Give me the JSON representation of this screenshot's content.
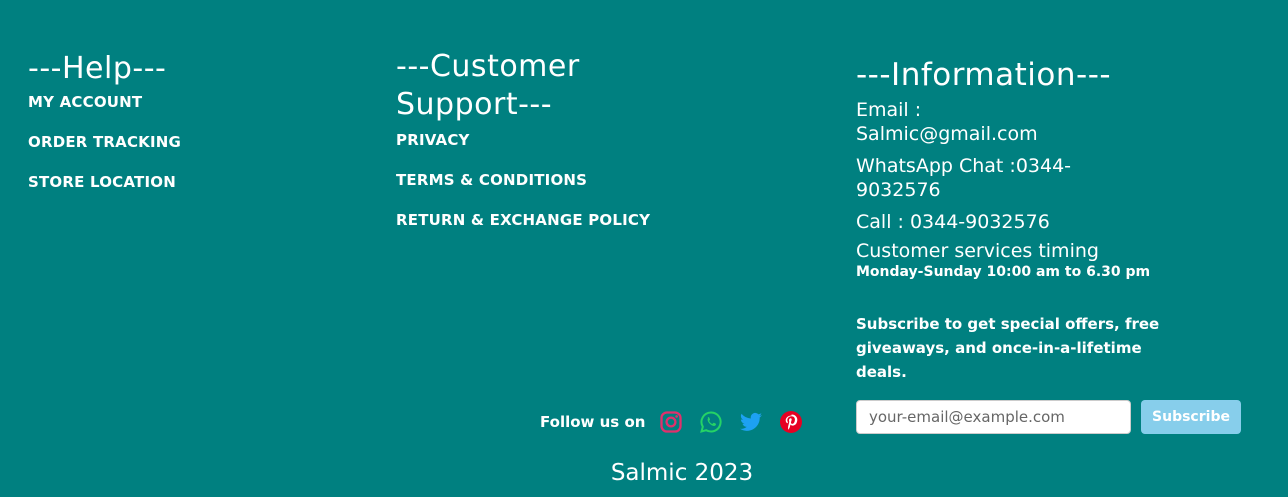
{
  "help": {
    "heading": "---Help---",
    "links": [
      "MY ACCOUNT",
      "ORDER TRACKING",
      "STORE LOCATION"
    ]
  },
  "support": {
    "heading": "---Customer Support---",
    "links": [
      "PRIVACY",
      "TERMS & CONDITIONS",
      "RETURN & EXCHANGE POLICY"
    ]
  },
  "info": {
    "heading": "---Information---",
    "email": "Email : Salmic@gmail.com",
    "whatsapp": "WhatsApp Chat :0344-9032576",
    "call": "Call : 0344-9032576",
    "timing_title": "Customer services timing",
    "timing_hours": "Monday-Sunday 10:00 am to 6.30 pm"
  },
  "subscribe": {
    "text": "Subscribe to get special offers, free giveaways, and once-in-a-lifetime deals.",
    "placeholder": "your-email@example.com",
    "button_label": "Subscribe"
  },
  "social": {
    "label": "Follow us on",
    "icons": [
      "instagram-icon",
      "whatsapp-icon",
      "twitter-icon",
      "pinterest-icon"
    ],
    "colors": {
      "instagram": "#e1306c",
      "whatsapp": "#25d366",
      "twitter": "#1da1f2",
      "pinterest": "#e60023"
    }
  },
  "footer": {
    "copyright": "Salmic 2023"
  },
  "colors": {
    "background": "#008080",
    "text": "#ffffff",
    "button": "#87ceeb"
  }
}
